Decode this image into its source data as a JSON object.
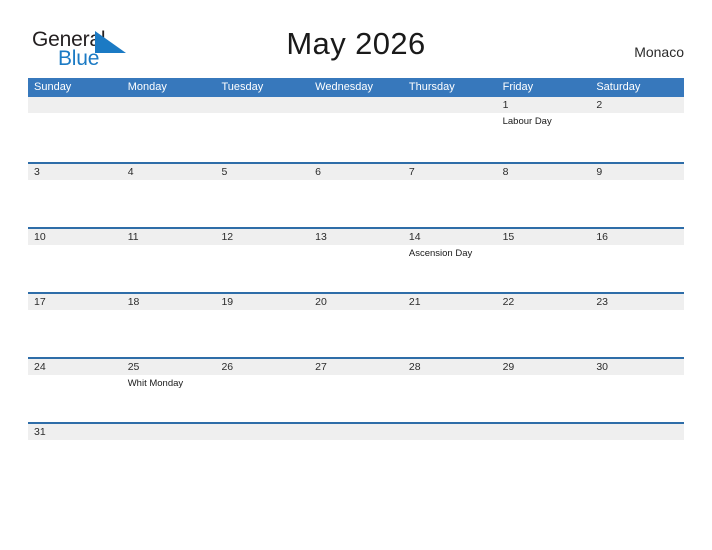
{
  "brand": {
    "name_part1": "General",
    "name_part2": "Blue",
    "logo_icon": "triangle-logo-icon",
    "color_dark": "#231f20",
    "color_blue": "#1b7ac4"
  },
  "header": {
    "title": "May 2026",
    "country": "Monaco"
  },
  "colors": {
    "header_blue": "#3778bc",
    "rule_blue": "#2e6da8",
    "date_band": "#efefef"
  },
  "calendar": {
    "weekdays": [
      "Sunday",
      "Monday",
      "Tuesday",
      "Wednesday",
      "Thursday",
      "Friday",
      "Saturday"
    ],
    "weeks": [
      {
        "days": [
          {
            "date": "",
            "event": ""
          },
          {
            "date": "",
            "event": ""
          },
          {
            "date": "",
            "event": ""
          },
          {
            "date": "",
            "event": ""
          },
          {
            "date": "",
            "event": ""
          },
          {
            "date": "1",
            "event": "Labour Day"
          },
          {
            "date": "2",
            "event": ""
          }
        ]
      },
      {
        "days": [
          {
            "date": "3",
            "event": ""
          },
          {
            "date": "4",
            "event": ""
          },
          {
            "date": "5",
            "event": ""
          },
          {
            "date": "6",
            "event": ""
          },
          {
            "date": "7",
            "event": ""
          },
          {
            "date": "8",
            "event": ""
          },
          {
            "date": "9",
            "event": ""
          }
        ]
      },
      {
        "days": [
          {
            "date": "10",
            "event": ""
          },
          {
            "date": "11",
            "event": ""
          },
          {
            "date": "12",
            "event": ""
          },
          {
            "date": "13",
            "event": ""
          },
          {
            "date": "14",
            "event": "Ascension Day"
          },
          {
            "date": "15",
            "event": ""
          },
          {
            "date": "16",
            "event": ""
          }
        ]
      },
      {
        "days": [
          {
            "date": "17",
            "event": ""
          },
          {
            "date": "18",
            "event": ""
          },
          {
            "date": "19",
            "event": ""
          },
          {
            "date": "20",
            "event": ""
          },
          {
            "date": "21",
            "event": ""
          },
          {
            "date": "22",
            "event": ""
          },
          {
            "date": "23",
            "event": ""
          }
        ]
      },
      {
        "days": [
          {
            "date": "24",
            "event": ""
          },
          {
            "date": "25",
            "event": "Whit Monday"
          },
          {
            "date": "26",
            "event": ""
          },
          {
            "date": "27",
            "event": ""
          },
          {
            "date": "28",
            "event": ""
          },
          {
            "date": "29",
            "event": ""
          },
          {
            "date": "30",
            "event": ""
          }
        ]
      },
      {
        "days": [
          {
            "date": "31",
            "event": ""
          },
          {
            "date": "",
            "event": ""
          },
          {
            "date": "",
            "event": ""
          },
          {
            "date": "",
            "event": ""
          },
          {
            "date": "",
            "event": ""
          },
          {
            "date": "",
            "event": ""
          },
          {
            "date": "",
            "event": ""
          }
        ]
      }
    ]
  }
}
